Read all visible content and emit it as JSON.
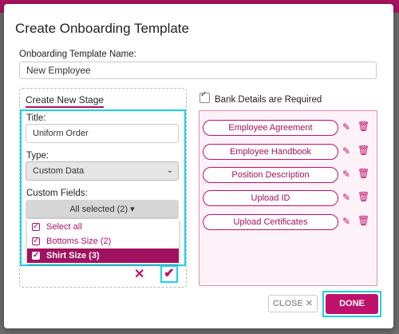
{
  "modal": {
    "title": "Create Onboarding Template",
    "template_name_label": "Onboarding Template Name:",
    "template_name_value": "New Employee"
  },
  "stage_form": {
    "heading": "Create New Stage",
    "title_label": "Title:",
    "title_value": "Uniform Order",
    "type_label": "Type:",
    "type_selected": "Custom Data",
    "custom_fields_label": "Custom Fields:",
    "custom_fields_button": "All selected (2)",
    "options": [
      {
        "label": "Select all",
        "checked": true
      },
      {
        "label": "Bottoms Size (2)",
        "checked": true
      },
      {
        "label": "Shirt Size (3)",
        "checked": true
      }
    ]
  },
  "bank_details": {
    "label": "Bank Details are Required",
    "checked": true
  },
  "stages": [
    "Employee Agreement",
    "Employee Handbook",
    "Position Description",
    "Upload ID",
    "Upload Certificates"
  ],
  "footer": {
    "close_label": "CLOSE",
    "done_label": "DONE"
  },
  "icons": {
    "edit": "pencil-square-icon",
    "delete": "trash-icon",
    "close": "x-icon",
    "confirm": "checkmark-icon"
  },
  "colors": {
    "brand": "#c0126a",
    "highlight": "#19d3e6"
  }
}
